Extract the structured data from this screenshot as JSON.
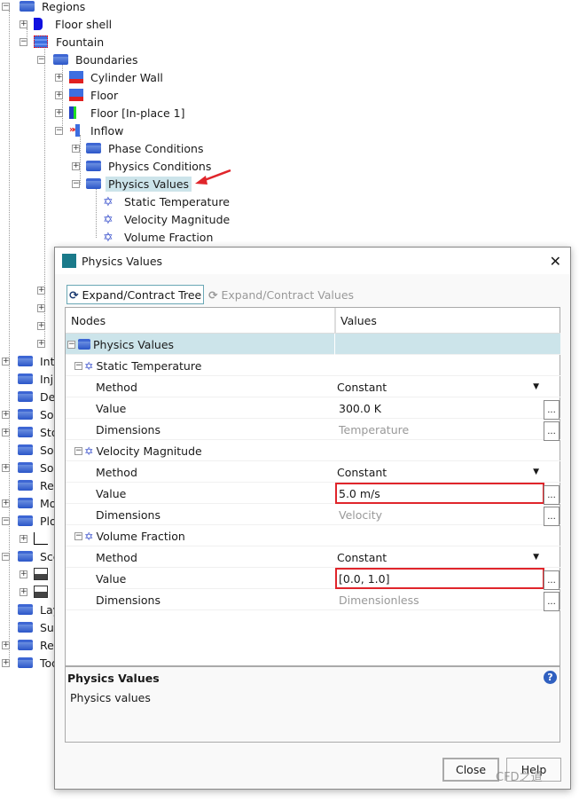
{
  "tree": {
    "regions": "Regions",
    "floor_shell": "Floor shell",
    "fountain": "Fountain",
    "boundaries": "Boundaries",
    "cylinder_wall": "Cylinder Wall",
    "floor": "Floor",
    "floor_inplace": "Floor [In-place 1]",
    "inflow": "Inflow",
    "phase_conditions": "Phase Conditions",
    "physics_conditions": "Physics Conditions",
    "physics_values": "Physics Values",
    "static_temperature": "Static Temperature",
    "velocity_magnitude": "Velocity Magnitude",
    "volume_fraction": "Volume Fraction",
    "top_items": [
      "Int",
      "Inj",
      "Der",
      "Sol",
      "Sto",
      "Sol",
      "Sol",
      "Rep",
      "Mo",
      "Plo",
      "Sce",
      "Lay",
      "Sur",
      "Rep",
      "Too"
    ]
  },
  "dialog": {
    "title": "Physics Values",
    "expand_tree": "Expand/Contract Tree",
    "expand_values": "Expand/Contract Values",
    "col_nodes": "Nodes",
    "col_values": "Values",
    "root": "Physics Values",
    "groups": [
      {
        "name": "Static Temperature",
        "method": "Constant",
        "value": "300.0 K",
        "dimensions": "Temperature",
        "highlight": false
      },
      {
        "name": "Velocity Magnitude",
        "method": "Constant",
        "value": "5.0 m/s",
        "dimensions": "Velocity",
        "highlight": true
      },
      {
        "name": "Volume Fraction",
        "method": "Constant",
        "value": "[0.0, 1.0]",
        "dimensions": "Dimensionless",
        "highlight": true
      }
    ],
    "labels": {
      "method": "Method",
      "value": "Value",
      "dimensions": "Dimensions",
      "ellipsis": "..."
    },
    "info_title": "Physics Values",
    "info_text": "Physics values",
    "close": "Close",
    "help": "Help"
  },
  "watermark": "CFD之道",
  "colors": {
    "selection": "#cce4ea",
    "highlight_box": "#e0252b",
    "arrow": "#e0252b"
  }
}
